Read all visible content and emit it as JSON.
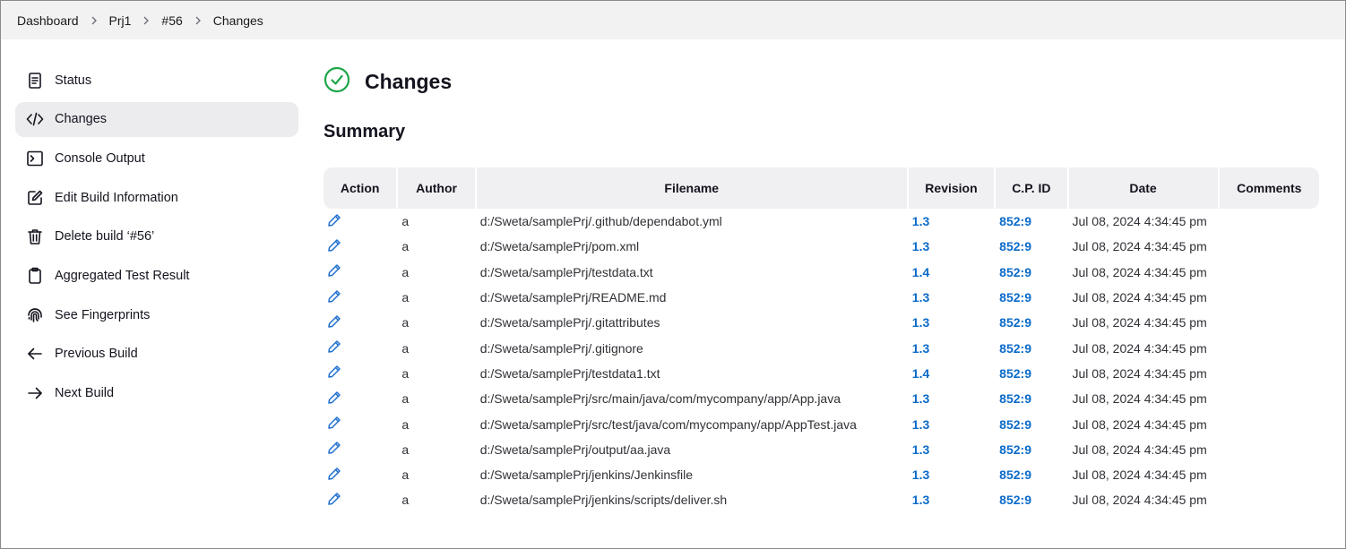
{
  "breadcrumb": {
    "items": [
      "Dashboard",
      "Prj1",
      "#56",
      "Changes"
    ]
  },
  "sidebar": {
    "items": [
      {
        "label": "Status",
        "icon": "document-icon"
      },
      {
        "label": "Changes",
        "icon": "code-icon",
        "active": true
      },
      {
        "label": "Console Output",
        "icon": "terminal-icon"
      },
      {
        "label": "Edit Build Information",
        "icon": "edit-icon"
      },
      {
        "label": "Delete build ‘#56’",
        "icon": "trash-icon"
      },
      {
        "label": "Aggregated Test Result",
        "icon": "clipboard-icon"
      },
      {
        "label": "See Fingerprints",
        "icon": "fingerprint-icon"
      },
      {
        "label": "Previous Build",
        "icon": "arrow-left-icon"
      },
      {
        "label": "Next Build",
        "icon": "arrow-right-icon"
      }
    ]
  },
  "main": {
    "title": "Changes",
    "status_color": "#1ea64a",
    "summary_heading": "Summary"
  },
  "table": {
    "headers": [
      "Action",
      "Author",
      "Filename",
      "Revision",
      "C.P. ID",
      "Date",
      "Comments"
    ],
    "rows": [
      {
        "author": "a",
        "filename": "d:/Sweta/samplePrj/.github/dependabot.yml",
        "revision": "1.3",
        "cpid": "852:9",
        "date": "Jul 08, 2024 4:34:45 pm",
        "comments": ""
      },
      {
        "author": "a",
        "filename": "d:/Sweta/samplePrj/pom.xml",
        "revision": "1.3",
        "cpid": "852:9",
        "date": "Jul 08, 2024 4:34:45 pm",
        "comments": ""
      },
      {
        "author": "a",
        "filename": "d:/Sweta/samplePrj/testdata.txt",
        "revision": "1.4",
        "cpid": "852:9",
        "date": "Jul 08, 2024 4:34:45 pm",
        "comments": ""
      },
      {
        "author": "a",
        "filename": "d:/Sweta/samplePrj/README.md",
        "revision": "1.3",
        "cpid": "852:9",
        "date": "Jul 08, 2024 4:34:45 pm",
        "comments": ""
      },
      {
        "author": "a",
        "filename": "d:/Sweta/samplePrj/.gitattributes",
        "revision": "1.3",
        "cpid": "852:9",
        "date": "Jul 08, 2024 4:34:45 pm",
        "comments": ""
      },
      {
        "author": "a",
        "filename": "d:/Sweta/samplePrj/.gitignore",
        "revision": "1.3",
        "cpid": "852:9",
        "date": "Jul 08, 2024 4:34:45 pm",
        "comments": ""
      },
      {
        "author": "a",
        "filename": "d:/Sweta/samplePrj/testdata1.txt",
        "revision": "1.4",
        "cpid": "852:9",
        "date": "Jul 08, 2024 4:34:45 pm",
        "comments": ""
      },
      {
        "author": "a",
        "filename": "d:/Sweta/samplePrj/src/main/java/com/mycompany/app/App.java",
        "revision": "1.3",
        "cpid": "852:9",
        "date": "Jul 08, 2024 4:34:45 pm",
        "comments": ""
      },
      {
        "author": "a",
        "filename": "d:/Sweta/samplePrj/src/test/java/com/mycompany/app/AppTest.java",
        "revision": "1.3",
        "cpid": "852:9",
        "date": "Jul 08, 2024 4:34:45 pm",
        "comments": ""
      },
      {
        "author": "a",
        "filename": "d:/Sweta/samplePrj/output/aa.java",
        "revision": "1.3",
        "cpid": "852:9",
        "date": "Jul 08, 2024 4:34:45 pm",
        "comments": ""
      },
      {
        "author": "a",
        "filename": "d:/Sweta/samplePrj/jenkins/Jenkinsfile",
        "revision": "1.3",
        "cpid": "852:9",
        "date": "Jul 08, 2024 4:34:45 pm",
        "comments": ""
      },
      {
        "author": "a",
        "filename": "d:/Sweta/samplePrj/jenkins/scripts/deliver.sh",
        "revision": "1.3",
        "cpid": "852:9",
        "date": "Jul 08, 2024 4:34:45 pm",
        "comments": ""
      }
    ]
  }
}
